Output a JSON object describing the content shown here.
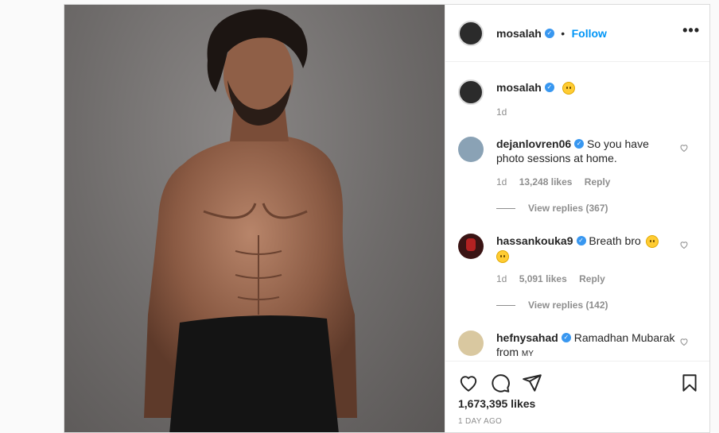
{
  "post": {
    "author": "mosalah",
    "follow_label": "Follow",
    "separator": "•",
    "more_label": "•••",
    "caption_time": "1d",
    "likes": "1,673,395 likes",
    "time_ago": "1 DAY AGO"
  },
  "comments": [
    {
      "username": "dejanlovren06",
      "text": "So you have photo sessions at home.",
      "time": "1d",
      "likes": "13,248 likes",
      "reply_label": "Reply",
      "view_replies": "View replies (367)"
    },
    {
      "username": "hassankouka9",
      "text": "Breath bro",
      "time": "1d",
      "likes": "5,091 likes",
      "reply_label": "Reply",
      "view_replies": "View replies (142)"
    },
    {
      "username": "hefnysahad",
      "text": "Ramadhan Mubarak from",
      "tail": "MY"
    }
  ],
  "icons": [
    "verified-badge-icon",
    "more-options-icon",
    "heart-icon",
    "comment-icon",
    "share-icon",
    "bookmark-icon",
    "smiley-emoji-icon",
    "laughing-emoji-icon",
    "tongue-emoji-icon"
  ],
  "colors": {
    "link": "#0095f6",
    "verified": "#3897f0",
    "muted": "#8e8e8e",
    "text": "#262626"
  }
}
